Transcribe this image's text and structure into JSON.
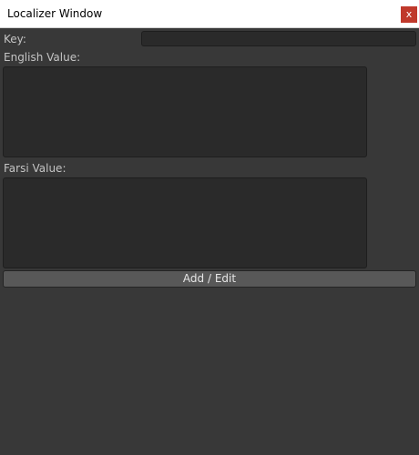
{
  "window": {
    "title": "Localizer Window",
    "close_label": "x"
  },
  "form": {
    "key_label": "Key:",
    "key_value": "",
    "english_label": "English Value:",
    "english_value": "",
    "farsi_label": "Farsi Value:",
    "farsi_value": "",
    "submit_label": "Add / Edit"
  },
  "colors": {
    "background": "#383838",
    "field": "#2a2a2a",
    "button": "#585858",
    "close": "#c0392b"
  }
}
